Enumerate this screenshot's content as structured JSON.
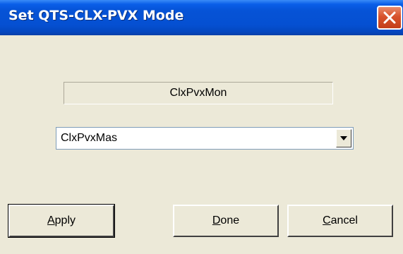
{
  "window": {
    "title": "Set QTS-CLX-PVX Mode"
  },
  "readout": {
    "value": "ClxPvxMon"
  },
  "mode_select": {
    "selected": "ClxPvxMas"
  },
  "buttons": {
    "apply": {
      "accel": "A",
      "rest": "pply"
    },
    "done": {
      "accel": "D",
      "rest": "one"
    },
    "cancel": {
      "accel": "C",
      "rest": "ancel"
    }
  },
  "colors": {
    "titlebar": "#0553d2",
    "close": "#d8522c",
    "dialog_bg": "#ece9d8"
  }
}
